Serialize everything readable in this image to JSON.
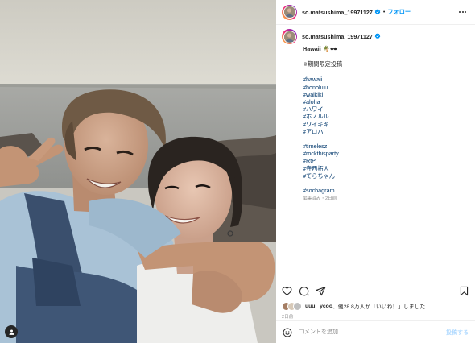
{
  "post": {
    "username": "so.matsushima_19971127",
    "follow_label": "フォロー",
    "caption_title": "Hawaii 🌴🕶",
    "caption_limited": "※期間限定投稿",
    "hashtag_groups": [
      [
        "#hawaii",
        "#honolulu",
        "#waikiki",
        "#aloha",
        "#ハワイ",
        "#ホノルル",
        "#ワイキキ",
        "#アロハ"
      ],
      [
        "#timelesz",
        "#rockthisparty",
        "#RtP",
        "#寺西拓人",
        "#てらちゃん"
      ],
      [
        "#sochagram"
      ]
    ],
    "edited_label": "編集済み・2日前",
    "likes_user": "uuui_ycoo",
    "likes_text": "、他28.8万人が「いいね！」しました",
    "date": "2日前",
    "comment_placeholder": "コメントを追加...",
    "post_button": "投稿する"
  },
  "icons": {
    "verified": "verified-badge-icon",
    "more": "more-options-icon",
    "like": "heart-icon",
    "comment": "comment-icon",
    "share": "share-icon",
    "save": "bookmark-icon",
    "emoji": "emoji-icon",
    "user_tag": "user-tag-icon"
  },
  "colors": {
    "link": "#0095f6",
    "hashtag": "#00376b",
    "verified": "#0095f6",
    "secondary_text": "#8e8e8e"
  }
}
